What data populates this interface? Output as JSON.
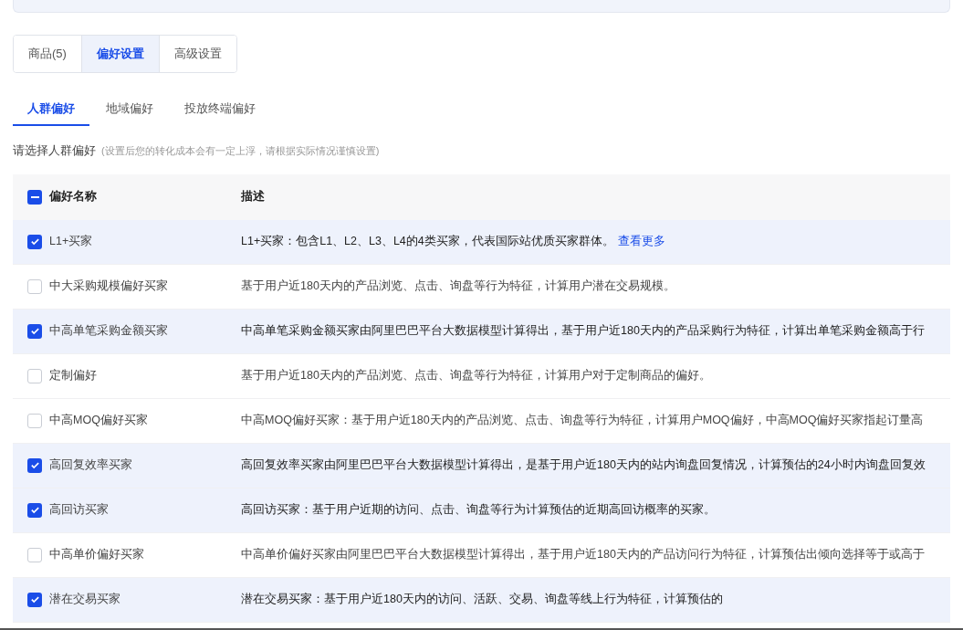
{
  "segment_tabs": [
    {
      "label": "商品(5)",
      "selected": false
    },
    {
      "label": "偏好设置",
      "selected": true
    },
    {
      "label": "高级设置",
      "selected": false
    }
  ],
  "sub_tabs": [
    {
      "label": "人群偏好",
      "selected": true
    },
    {
      "label": "地域偏好",
      "selected": false
    },
    {
      "label": "投放终端偏好",
      "selected": false
    }
  ],
  "prompt": {
    "label": "请选择人群偏好",
    "hint": "(设置后您的转化成本会有一定上浮，请根据实际情况谨慎设置)"
  },
  "table": {
    "select_all_partial": true,
    "columns": [
      "偏好名称",
      "描述"
    ],
    "rows": [
      {
        "name": "L1+买家",
        "checked": true,
        "description": "L1+买家：包含L1、L2、L3、L4的4类买家，代表国际站优质买家群体。",
        "link": "查看更多"
      },
      {
        "name": "中大采购规模偏好买家",
        "checked": false,
        "description": "基于用户近180天内的产品浏览、点击、询盘等行为特征，计算用户潜在交易规模。"
      },
      {
        "name": "中高单笔采购金额买家",
        "checked": true,
        "description": "中高单笔采购金额买家由阿里巴巴平台大数据模型计算得出，基于用户近180天内的产品采购行为特征，计算出单笔采购金额高于行"
      },
      {
        "name": "定制偏好",
        "checked": false,
        "description": "基于用户近180天内的产品浏览、点击、询盘等行为特征，计算用户对于定制商品的偏好。"
      },
      {
        "name": "中高MOQ偏好买家",
        "checked": false,
        "description": "中高MOQ偏好买家：基于用户近180天内的产品浏览、点击、询盘等行为特征，计算用户MOQ偏好，中高MOQ偏好买家指起订量高"
      },
      {
        "name": "高回复效率买家",
        "checked": true,
        "description": "高回复效率买家由阿里巴巴平台大数据模型计算得出，是基于用户近180天内的站内询盘回复情况，计算预估的24小时内询盘回复效"
      },
      {
        "name": "高回访买家",
        "checked": true,
        "description": "高回访买家：基于用户近期的访问、点击、询盘等行为计算预估的近期高回访概率的买家。"
      },
      {
        "name": "中高单价偏好买家",
        "checked": false,
        "description": "中高单价偏好买家由阿里巴巴平台大数据模型计算得出，基于用户近180天内的产品访问行为特征，计算预估出倾向选择等于或高于"
      },
      {
        "name": "潜在交易买家",
        "checked": true,
        "description": "潜在交易买家：基于用户近180天内的访问、活跃、交易、询盘等线上行为特征，计算预估的"
      }
    ]
  }
}
